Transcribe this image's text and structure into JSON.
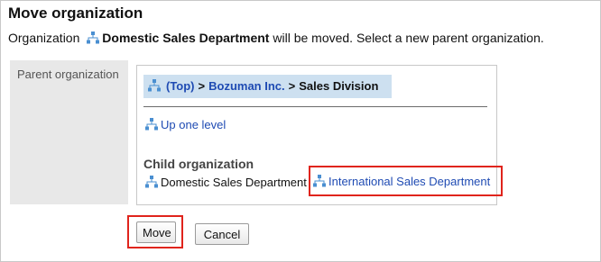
{
  "header": {
    "title": "Move organization",
    "desc_prefix": "Organization",
    "org_name": "Domestic Sales Department",
    "desc_suffix": "will be moved. Select a new parent organization."
  },
  "form": {
    "parent_label": "Parent organization"
  },
  "breadcrumb": {
    "items": [
      {
        "label": "(Top)",
        "link": true
      },
      {
        "label": "Bozuman Inc.",
        "link": true
      },
      {
        "label": "Sales Division",
        "link": false
      }
    ],
    "separator": ">"
  },
  "navigation": {
    "up_level": "Up one level"
  },
  "children": {
    "heading": "Child organization",
    "items": [
      {
        "label": "Domestic Sales Department",
        "link": false
      },
      {
        "label": "International Sales Department",
        "link": true
      }
    ]
  },
  "actions": {
    "move_label": "Move",
    "cancel_label": "Cancel"
  },
  "colors": {
    "link": "#1f4bb3",
    "highlight": "#e0241c",
    "breadcrumb_bg": "#cde0f0",
    "org_icon": "#4a8fd1"
  }
}
